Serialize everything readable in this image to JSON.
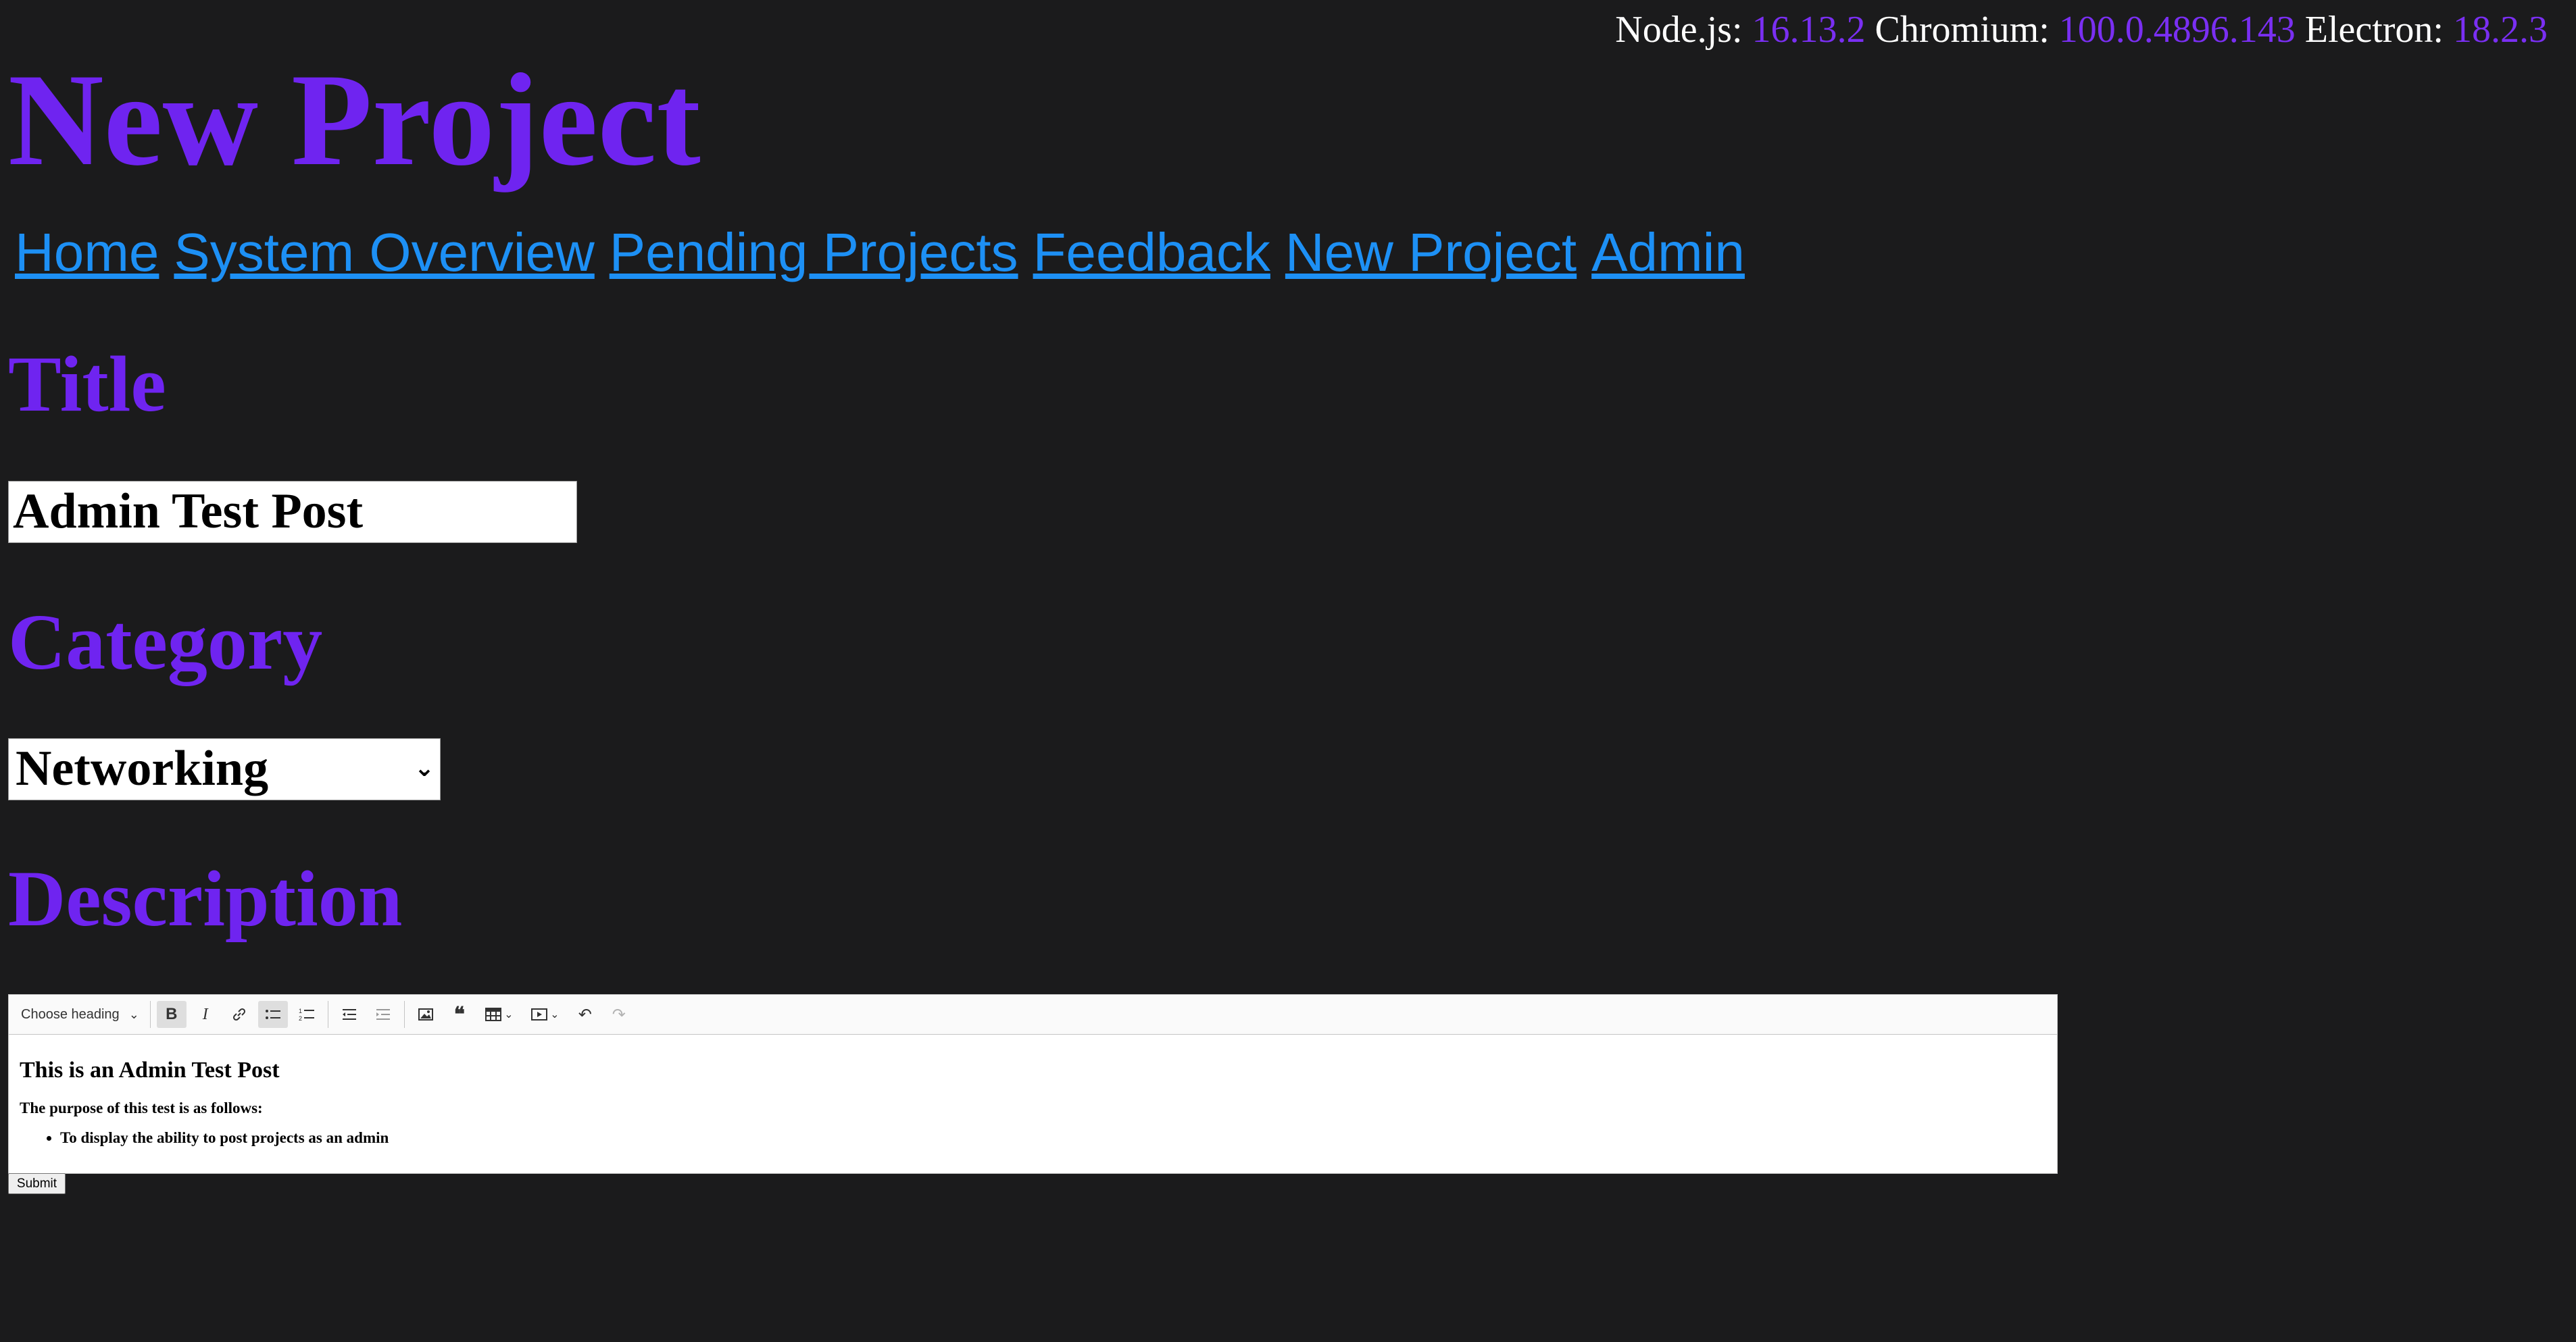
{
  "versions": {
    "node_label": "Node.js:",
    "node_version": "16.13.2",
    "chromium_label": "Chromium:",
    "chromium_version": "100.0.4896.143",
    "electron_label": "Electron:",
    "electron_version": "18.2.3"
  },
  "page_title": "New Project",
  "nav": {
    "items": [
      "Home",
      "System Overview",
      "Pending Projects",
      "Feedback",
      "New Project",
      "Admin"
    ]
  },
  "form": {
    "title_heading": "Title",
    "title_value": "Admin Test Post",
    "category_heading": "Category",
    "category_value": "Networking",
    "description_heading": "Description",
    "submit_label": "Submit"
  },
  "editor": {
    "heading_dropdown": "Choose heading",
    "toolbar_icons": [
      "bold-icon",
      "italic-icon",
      "link-icon",
      "bulleted-list-icon",
      "numbered-list-icon",
      "outdent-icon",
      "indent-icon",
      "insert-image-icon",
      "block-quote-icon",
      "insert-table-icon",
      "insert-media-icon",
      "undo-icon",
      "redo-icon"
    ],
    "content": {
      "heading": "This is an Admin Test Post",
      "paragraph": "The purpose of this test is as follows:",
      "bullets": [
        "To display the ability to post projects as an admin"
      ]
    }
  },
  "colors": {
    "background": "#1b1b1c",
    "heading_purple": "#6f24f0",
    "version_purple": "#7a2ff2",
    "link_blue": "#1d90f5"
  }
}
